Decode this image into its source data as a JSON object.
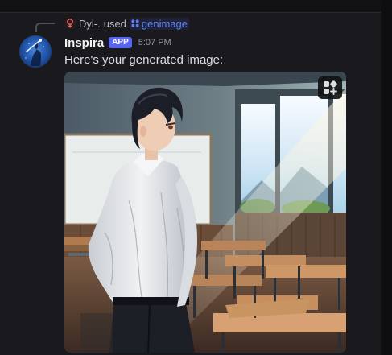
{
  "reply": {
    "user": "Dyl-.",
    "used_text": "used",
    "command": "genimage",
    "command_icon": "app-command-icon"
  },
  "message": {
    "author": "Inspira",
    "badge": "APP",
    "time": "5:07 PM",
    "text": "Here's your generated image:",
    "avatar_icon": "inspira-avatar"
  },
  "attachment": {
    "subject": "anime boy in white shirt standing in sunlit classroom",
    "action_icon": "image-actions-icon"
  },
  "colors": {
    "background": "#1a1a1e",
    "accent": "#5865f2",
    "link": "#5a82f5",
    "text": "#dbdee1",
    "muted": "#949ba4"
  }
}
